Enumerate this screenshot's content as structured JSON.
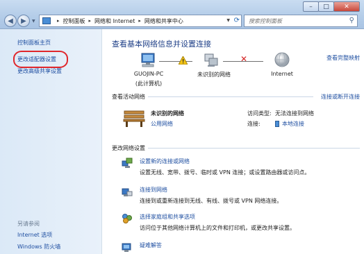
{
  "window": {
    "controls": {
      "minimize": "–",
      "maximize": "□",
      "close": "✕"
    }
  },
  "address": {
    "breadcrumbs": [
      "控制面板",
      "网络和 Internet",
      "网络和共享中心"
    ],
    "separator": "▸"
  },
  "search": {
    "placeholder": "搜索控制面板"
  },
  "sidebar": {
    "home": "控制面板主页",
    "adapter_settings": "更改适配器设置",
    "advanced_sharing": "更改高级共享设置",
    "see_also": "另请参阅",
    "internet_options": "Internet 选项",
    "firewall": "Windows 防火墙"
  },
  "main": {
    "title": "查看基本网络信息并设置连接",
    "full_map": "查看完整映射",
    "netmap": {
      "computer_name": "GUOJIN-PC",
      "computer_sub": "(此计算机)",
      "unknown_network": "未识别的网络",
      "internet": "Internet"
    },
    "active_networks": {
      "heading": "查看活动网络",
      "connect_disconnect": "连接或断开连接",
      "network_name": "未识别的网络",
      "network_type": "公用网络",
      "access_label": "访问类型:",
      "access_value": "无法连接到网络",
      "connection_label": "连接:",
      "connection_value": "本地连接"
    },
    "change_settings": {
      "heading": "更改网络设置",
      "tasks": [
        {
          "link": "设置新的连接或网络",
          "desc": "设置无线、宽带、拨号、临时或 VPN 连接；或设置路由器或访问点。"
        },
        {
          "link": "连接到网络",
          "desc": "连接到或重新连接到无线、有线、拨号或 VPN 网络连接。"
        },
        {
          "link": "选择家庭组和共享选项",
          "desc": "访问位于其他网络计算机上的文件和打印机，或更改共享设置。"
        },
        {
          "link": "疑难解答"
        }
      ]
    }
  },
  "colors": {
    "link": "#1f4fa1",
    "title": "#1e3f87",
    "highlight_circle": "#e0262b"
  }
}
